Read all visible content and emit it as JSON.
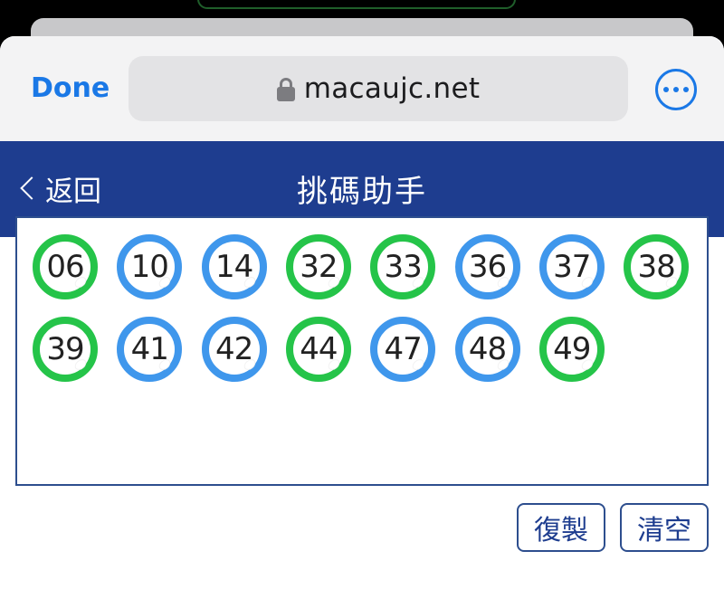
{
  "browser": {
    "done_label": "Done",
    "url": "macaujc.net",
    "lock_icon": "lock-icon",
    "more_icon": "ellipsis-circle-icon",
    "accent": "#1a78e6"
  },
  "header": {
    "back_label": "返回",
    "back_icon": "chevron-left-icon",
    "title": "挑碼助手",
    "background": "#1e3d8f"
  },
  "balls": [
    {
      "number": "06",
      "color": "green"
    },
    {
      "number": "10",
      "color": "blue"
    },
    {
      "number": "14",
      "color": "blue"
    },
    {
      "number": "32",
      "color": "green"
    },
    {
      "number": "33",
      "color": "green"
    },
    {
      "number": "36",
      "color": "blue"
    },
    {
      "number": "37",
      "color": "blue"
    },
    {
      "number": "38",
      "color": "green"
    },
    {
      "number": "39",
      "color": "green"
    },
    {
      "number": "41",
      "color": "blue"
    },
    {
      "number": "42",
      "color": "blue"
    },
    {
      "number": "44",
      "color": "green"
    },
    {
      "number": "47",
      "color": "blue"
    },
    {
      "number": "48",
      "color": "blue"
    },
    {
      "number": "49",
      "color": "green"
    }
  ],
  "ball_colors": {
    "green": "#25c449",
    "blue": "#3f97ec"
  },
  "actions": {
    "copy_label": "復製",
    "clear_label": "清空"
  }
}
